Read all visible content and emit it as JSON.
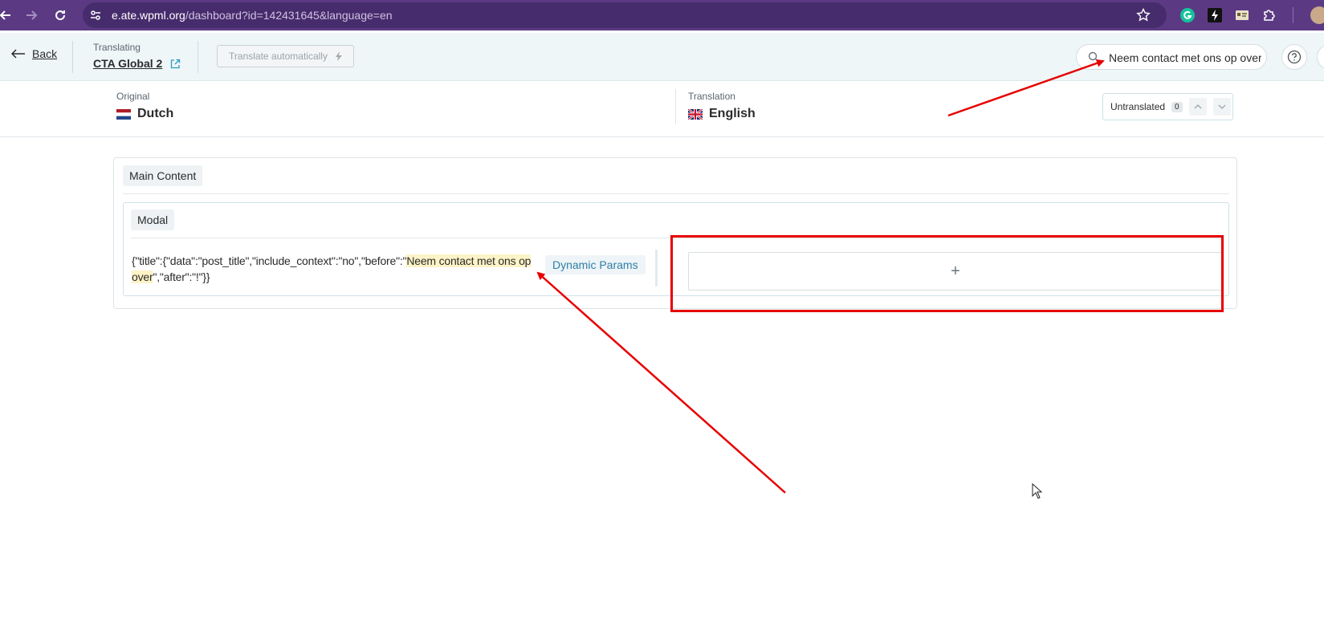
{
  "browser": {
    "url_host": "e.ate.wpml.org",
    "url_path": "/dashboard?id=142431645&language=en"
  },
  "header": {
    "back_label": "Back",
    "translating_label": "Translating",
    "doc_title": "CTA Global 2",
    "auto_translate_label": "Translate automatically",
    "search_value": "Neem contact met ons op over"
  },
  "languages": {
    "original_label": "Original",
    "original_lang": "Dutch",
    "translation_label": "Translation",
    "translation_lang": "English",
    "untranslated_label": "Untranslated",
    "untranslated_count": "0"
  },
  "content": {
    "section_tag": "Main Content",
    "subsection_tag": "Modal",
    "source_prefix": "{\"title\":{\"data\":\"post_title\",\"include_context\":\"no\",\"before\":\"",
    "source_highlight": "Neem contact met ons op over",
    "source_suffix": "\",\"after\":\"!\"}}",
    "dynamic_params_label": "Dynamic Params",
    "add_translation_symbol": "+"
  },
  "colors": {
    "browser_bar": "#5b3a83",
    "header_bg": "#eef6f8",
    "annotation_red": "#e60000",
    "highlight": "#fdf3c7"
  }
}
